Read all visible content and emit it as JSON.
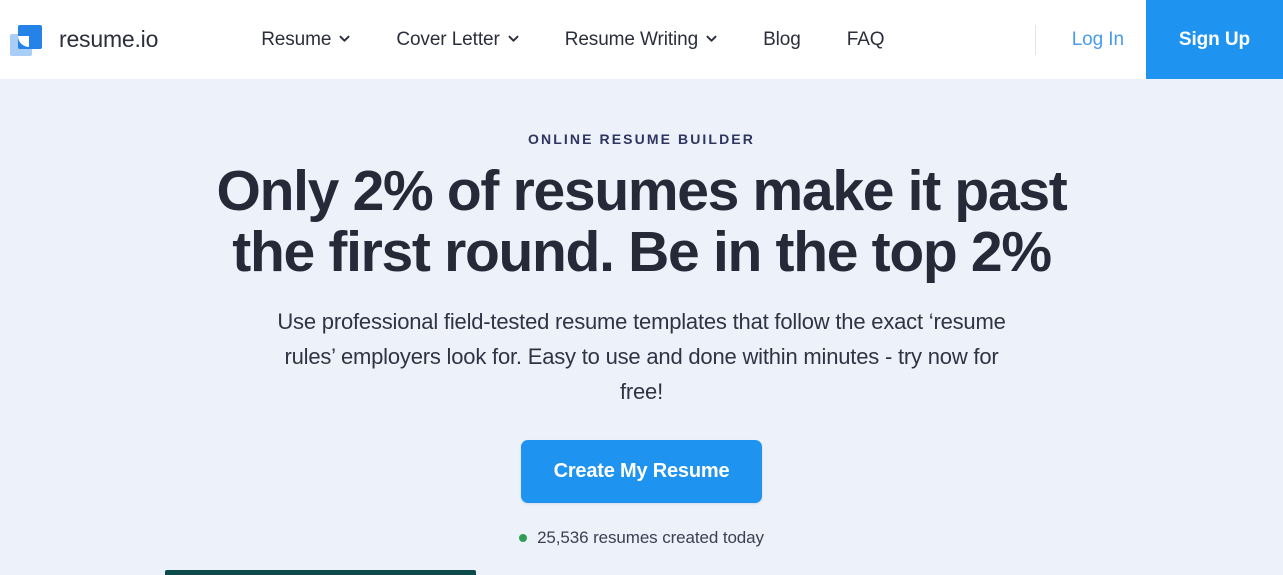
{
  "brand": {
    "name": "resume.io",
    "logo_icon": "resume-io-logo-icon",
    "colors": {
      "logo_front": "#2583e8",
      "logo_back": "#a8cdf6"
    }
  },
  "header": {
    "nav_items": [
      {
        "label": "Resume",
        "has_dropdown": true,
        "icon": "chevron-down-icon"
      },
      {
        "label": "Cover Letter",
        "has_dropdown": true,
        "icon": "chevron-down-icon"
      },
      {
        "label": "Resume Writing",
        "has_dropdown": true,
        "icon": "chevron-down-icon"
      },
      {
        "label": "Blog",
        "has_dropdown": false
      },
      {
        "label": "FAQ",
        "has_dropdown": false
      }
    ],
    "login_label": "Log In",
    "signup_label": "Sign Up",
    "accent_color": "#1f93f0",
    "login_color": "#4a9ceb"
  },
  "hero": {
    "eyebrow": "ONLINE RESUME BUILDER",
    "headline": "Only 2% of resumes make it past the first round. Be in the top 2%",
    "subhead": "Use professional field-tested resume templates that follow the exact ‘resume rules’ employers look for. Easy to use and done within minutes - try now for free!",
    "cta_label": "Create My Resume",
    "counter_text": "25,536 resumes created today",
    "counter_dot_color": "#2e9e54",
    "background_color": "#edf1fa",
    "headline_color": "#252a38"
  },
  "bottom_strip": {
    "color": "#0d4c4a"
  }
}
